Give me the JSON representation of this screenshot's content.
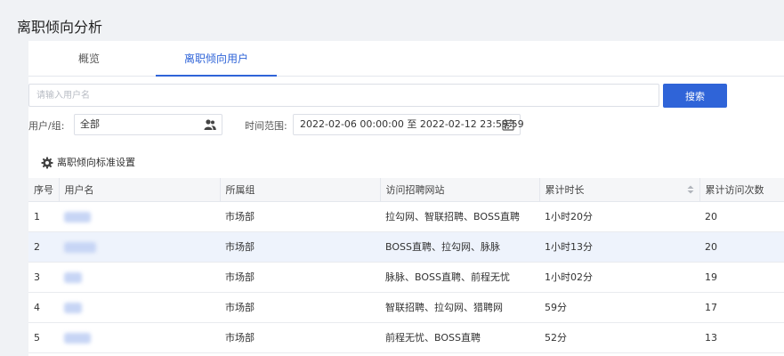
{
  "page": {
    "title": "离职倾向分析"
  },
  "tabs": [
    {
      "label": "概览"
    },
    {
      "label": "离职倾向用户"
    }
  ],
  "search": {
    "placeholder": "请输入用户名",
    "value": "",
    "button_label": "搜索"
  },
  "filters": {
    "group_label": "用户/组:",
    "group_value": "全部",
    "time_label": "时间范围:",
    "time_value": "2022-02-06 00:00:00 至 2022-02-12 23:59:59"
  },
  "settings": {
    "label": "离职倾向标准设置"
  },
  "table": {
    "columns": [
      "序号",
      "用户名",
      "所属组",
      "访问招聘网站",
      "累计时长",
      "累计访问次数"
    ],
    "rows": [
      {
        "index": "1",
        "username": "",
        "group": "市场部",
        "sites": "拉勾网、智联招聘、BOSS直聘",
        "duration": "1小时20分",
        "visits": "20"
      },
      {
        "index": "2",
        "username": "",
        "group": "市场部",
        "sites": "BOSS直聘、拉勾网、脉脉",
        "duration": "1小时13分",
        "visits": "20"
      },
      {
        "index": "3",
        "username": "",
        "group": "市场部",
        "sites": "脉脉、BOSS直聘、前程无忧",
        "duration": "1小时02分",
        "visits": "19"
      },
      {
        "index": "4",
        "username": "",
        "group": "市场部",
        "sites": "智联招聘、拉勾网、猎聘网",
        "duration": "59分",
        "visits": "17"
      },
      {
        "index": "5",
        "username": "",
        "group": "市场部",
        "sites": "前程无忧、BOSS直聘",
        "duration": "52分",
        "visits": "13"
      }
    ]
  },
  "colors": {
    "accent": "#2f64d8",
    "header_bg": "#f5f6f8",
    "highlight_row": "#eef3fc"
  },
  "icons": {
    "group": "user-group-icon",
    "date": "calendar-icon",
    "settings": "gear-icon",
    "sort": "sort-icon"
  }
}
